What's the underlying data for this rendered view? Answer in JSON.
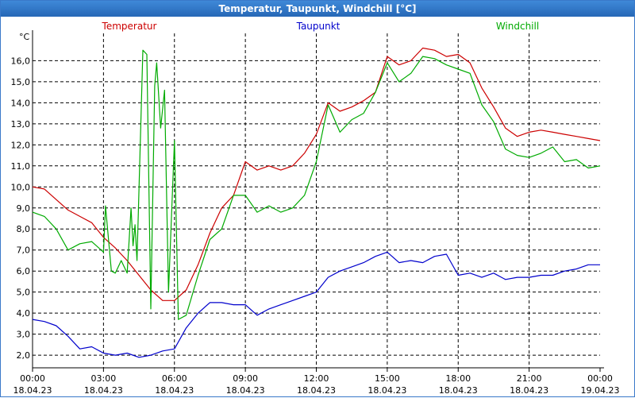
{
  "window": {
    "title": "Temperatur, Taupunkt, Windchill [°C]"
  },
  "chart_data": {
    "type": "line",
    "title": "Temperatur, Taupunkt, Windchill [°C]",
    "ylabel": "°C",
    "xlim": [
      "18.04.23 00:00",
      "19.04.23 00:00"
    ],
    "ylim": [
      1.4,
      17.3
    ],
    "grid": true,
    "legend_position": "top",
    "x_ticks": [
      {
        "time": "00:00",
        "date": "18.04.23"
      },
      {
        "time": "03:00",
        "date": "18.04.23"
      },
      {
        "time": "06:00",
        "date": "18.04.23"
      },
      {
        "time": "09:00",
        "date": "18.04.23"
      },
      {
        "time": "12:00",
        "date": "18.04.23"
      },
      {
        "time": "15:00",
        "date": "18.04.23"
      },
      {
        "time": "18:00",
        "date": "18.04.23"
      },
      {
        "time": "21:00",
        "date": "18.04.23"
      },
      {
        "time": "00:00",
        "date": "19.04.23"
      }
    ],
    "y_ticks": [
      "2,0",
      "3,0",
      "4,0",
      "5,0",
      "6,0",
      "7,0",
      "8,0",
      "9,0",
      "10,0",
      "11,0",
      "12,0",
      "13,0",
      "14,0",
      "15,0",
      "16,0"
    ],
    "series": [
      {
        "name": "Temperatur",
        "color": "#cc0000",
        "points": [
          [
            "00:00",
            10.0
          ],
          [
            "00:30",
            9.9
          ],
          [
            "01:00",
            9.4
          ],
          [
            "01:30",
            8.9
          ],
          [
            "02:00",
            8.6
          ],
          [
            "02:30",
            8.3
          ],
          [
            "03:00",
            7.6
          ],
          [
            "03:30",
            7.1
          ],
          [
            "04:00",
            6.5
          ],
          [
            "04:30",
            5.8
          ],
          [
            "05:00",
            5.1
          ],
          [
            "05:30",
            4.6
          ],
          [
            "06:00",
            4.6
          ],
          [
            "06:30",
            5.1
          ],
          [
            "07:00",
            6.3
          ],
          [
            "07:30",
            7.8
          ],
          [
            "08:00",
            9.0
          ],
          [
            "08:30",
            9.6
          ],
          [
            "09:00",
            11.2
          ],
          [
            "09:30",
            10.8
          ],
          [
            "10:00",
            11.0
          ],
          [
            "10:30",
            10.8
          ],
          [
            "11:00",
            11.0
          ],
          [
            "11:30",
            11.6
          ],
          [
            "12:00",
            12.5
          ],
          [
            "12:30",
            14.0
          ],
          [
            "13:00",
            13.6
          ],
          [
            "13:30",
            13.8
          ],
          [
            "14:00",
            14.1
          ],
          [
            "14:30",
            14.5
          ],
          [
            "15:00",
            16.2
          ],
          [
            "15:30",
            15.8
          ],
          [
            "16:00",
            16.0
          ],
          [
            "16:30",
            16.6
          ],
          [
            "17:00",
            16.5
          ],
          [
            "17:30",
            16.2
          ],
          [
            "18:00",
            16.3
          ],
          [
            "18:30",
            15.9
          ],
          [
            "19:00",
            14.7
          ],
          [
            "19:30",
            13.8
          ],
          [
            "20:00",
            12.8
          ],
          [
            "20:30",
            12.4
          ],
          [
            "21:00",
            12.6
          ],
          [
            "21:30",
            12.7
          ],
          [
            "22:00",
            12.6
          ],
          [
            "22:30",
            12.5
          ],
          [
            "23:00",
            12.4
          ],
          [
            "23:30",
            12.3
          ],
          [
            "24:00",
            12.2
          ]
        ]
      },
      {
        "name": "Taupunkt",
        "color": "#0000cc",
        "points": [
          [
            "00:00",
            3.7
          ],
          [
            "00:30",
            3.6
          ],
          [
            "01:00",
            3.4
          ],
          [
            "01:30",
            2.9
          ],
          [
            "02:00",
            2.3
          ],
          [
            "02:30",
            2.4
          ],
          [
            "03:00",
            2.1
          ],
          [
            "03:30",
            2.0
          ],
          [
            "04:00",
            2.1
          ],
          [
            "04:30",
            1.9
          ],
          [
            "05:00",
            2.0
          ],
          [
            "05:30",
            2.2
          ],
          [
            "06:00",
            2.3
          ],
          [
            "06:30",
            3.3
          ],
          [
            "07:00",
            4.0
          ],
          [
            "07:30",
            4.5
          ],
          [
            "08:00",
            4.5
          ],
          [
            "08:30",
            4.4
          ],
          [
            "09:00",
            4.4
          ],
          [
            "09:30",
            3.9
          ],
          [
            "10:00",
            4.2
          ],
          [
            "10:30",
            4.4
          ],
          [
            "11:00",
            4.6
          ],
          [
            "11:30",
            4.8
          ],
          [
            "12:00",
            5.0
          ],
          [
            "12:30",
            5.7
          ],
          [
            "13:00",
            6.0
          ],
          [
            "13:30",
            6.2
          ],
          [
            "14:00",
            6.4
          ],
          [
            "14:30",
            6.7
          ],
          [
            "15:00",
            6.9
          ],
          [
            "15:30",
            6.4
          ],
          [
            "16:00",
            6.5
          ],
          [
            "16:30",
            6.4
          ],
          [
            "17:00",
            6.7
          ],
          [
            "17:30",
            6.8
          ],
          [
            "18:00",
            5.8
          ],
          [
            "18:30",
            5.9
          ],
          [
            "19:00",
            5.7
          ],
          [
            "19:30",
            5.9
          ],
          [
            "20:00",
            5.6
          ],
          [
            "20:30",
            5.7
          ],
          [
            "21:00",
            5.7
          ],
          [
            "21:30",
            5.8
          ],
          [
            "22:00",
            5.8
          ],
          [
            "22:30",
            6.0
          ],
          [
            "23:00",
            6.1
          ],
          [
            "23:30",
            6.3
          ],
          [
            "24:00",
            6.3
          ]
        ]
      },
      {
        "name": "Windchill",
        "color": "#00aa00",
        "points": [
          [
            "00:00",
            8.8
          ],
          [
            "00:30",
            8.6
          ],
          [
            "01:00",
            8.0
          ],
          [
            "01:30",
            7.0
          ],
          [
            "02:00",
            7.3
          ],
          [
            "02:30",
            7.4
          ],
          [
            "03:00",
            6.9
          ],
          [
            "03:05",
            9.1
          ],
          [
            "03:20",
            6.0
          ],
          [
            "03:30",
            5.9
          ],
          [
            "03:45",
            6.5
          ],
          [
            "04:00",
            5.9
          ],
          [
            "04:10",
            9.0
          ],
          [
            "04:15",
            7.2
          ],
          [
            "04:20",
            8.2
          ],
          [
            "04:25",
            6.5
          ],
          [
            "04:40",
            16.5
          ],
          [
            "04:50",
            16.3
          ],
          [
            "05:00",
            4.2
          ],
          [
            "05:10",
            14.8
          ],
          [
            "05:15",
            15.9
          ],
          [
            "05:25",
            12.8
          ],
          [
            "05:35",
            14.6
          ],
          [
            "05:45",
            5.0
          ],
          [
            "06:00",
            12.2
          ],
          [
            "06:10",
            3.7
          ],
          [
            "06:30",
            3.9
          ],
          [
            "07:00",
            5.8
          ],
          [
            "07:30",
            7.5
          ],
          [
            "08:00",
            8.0
          ],
          [
            "08:30",
            9.6
          ],
          [
            "09:00",
            9.6
          ],
          [
            "09:30",
            8.8
          ],
          [
            "10:00",
            9.1
          ],
          [
            "10:30",
            8.8
          ],
          [
            "11:00",
            9.0
          ],
          [
            "11:30",
            9.6
          ],
          [
            "12:00",
            11.2
          ],
          [
            "12:30",
            13.9
          ],
          [
            "13:00",
            12.6
          ],
          [
            "13:30",
            13.2
          ],
          [
            "14:00",
            13.5
          ],
          [
            "14:30",
            14.5
          ],
          [
            "15:00",
            15.9
          ],
          [
            "15:30",
            15.0
          ],
          [
            "16:00",
            15.4
          ],
          [
            "16:30",
            16.2
          ],
          [
            "17:00",
            16.1
          ],
          [
            "17:30",
            15.8
          ],
          [
            "18:00",
            15.6
          ],
          [
            "18:30",
            15.4
          ],
          [
            "19:00",
            13.9
          ],
          [
            "19:30",
            13.1
          ],
          [
            "20:00",
            11.8
          ],
          [
            "20:30",
            11.5
          ],
          [
            "21:00",
            11.4
          ],
          [
            "21:30",
            11.6
          ],
          [
            "22:00",
            11.9
          ],
          [
            "22:30",
            11.2
          ],
          [
            "23:00",
            11.3
          ],
          [
            "23:30",
            10.9
          ],
          [
            "24:00",
            11.0
          ]
        ]
      }
    ]
  }
}
